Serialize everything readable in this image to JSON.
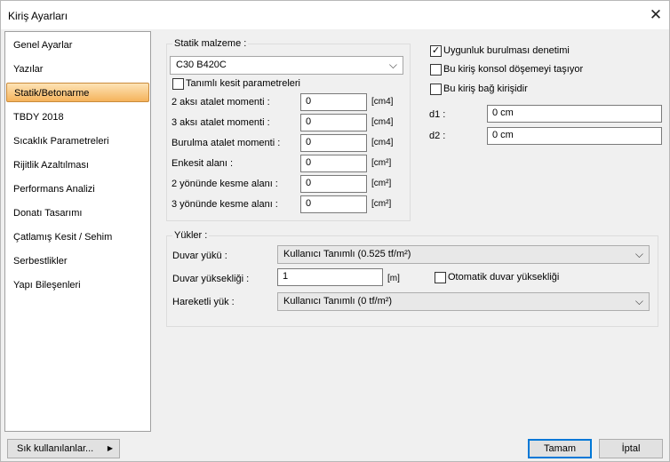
{
  "window": {
    "title": "Kiriş Ayarları"
  },
  "sidebar": {
    "items": [
      {
        "label": "Genel Ayarlar"
      },
      {
        "label": "Yazılar"
      },
      {
        "label": "Statik/Betonarme"
      },
      {
        "label": "TBDY 2018"
      },
      {
        "label": "Sıcaklık Parametreleri"
      },
      {
        "label": "Rijitlik Azaltılması"
      },
      {
        "label": "Performans Analizi"
      },
      {
        "label": "Donatı Tasarımı"
      },
      {
        "label": "Çatlamış Kesit / Sehim"
      },
      {
        "label": "Serbestlikler"
      },
      {
        "label": "Yapı Bileşenleri"
      }
    ],
    "active_index": 2
  },
  "statik": {
    "legend": "Statik malzeme :",
    "material": "C30 B420C",
    "custom_section_label": "Tanımlı kesit parametreleri",
    "custom_section_checked": false,
    "params": [
      {
        "label": "2 aksı atalet momenti :",
        "value": "0",
        "unit": "[cm4]"
      },
      {
        "label": "3 aksı atalet momenti :",
        "value": "0",
        "unit": "[cm4]"
      },
      {
        "label": "Burulma atalet momenti :",
        "value": "0",
        "unit": "[cm4]"
      },
      {
        "label": "Enkesit alanı :",
        "value": "0",
        "unit": "[cm²]"
      },
      {
        "label": "2 yönünde kesme alanı :",
        "value": "0",
        "unit": "[cm²]"
      },
      {
        "label": "3 yönünde kesme alanı :",
        "value": "0",
        "unit": "[cm²]"
      }
    ]
  },
  "options": {
    "torsion_check": {
      "label": "Uygunluk burulması denetimi",
      "checked": true
    },
    "cantilever_slab": {
      "label": "Bu kiriş konsol döşemeyi taşıyor",
      "checked": false
    },
    "tie_beam": {
      "label": "Bu kiriş bağ kirişidir",
      "checked": false
    },
    "d1": {
      "label": "d1 :",
      "value": "0 cm"
    },
    "d2": {
      "label": "d2 :",
      "value": "0 cm"
    }
  },
  "loads": {
    "legend": "Yükler :",
    "wall_load": {
      "label": "Duvar yükü :",
      "value": "Kullanıcı Tanımlı (0.525 tf/m²)"
    },
    "wall_height": {
      "label": "Duvar yüksekliği :",
      "value": "1",
      "unit": "[m]"
    },
    "auto_height": {
      "label": "Otomatik duvar yüksekliği",
      "checked": false
    },
    "live_load": {
      "label": "Hareketli yük :",
      "value": "Kullanıcı Tanımlı (0 tf/m²)"
    }
  },
  "footer": {
    "frequent_label": "Sık kullanılanlar...",
    "ok_label": "Tamam",
    "cancel_label": "İptal"
  },
  "icons": {
    "close": "close-icon",
    "dropdown": "chevron-down-icon",
    "submenu": "triangle-right-icon",
    "check": "checkmark-icon"
  }
}
